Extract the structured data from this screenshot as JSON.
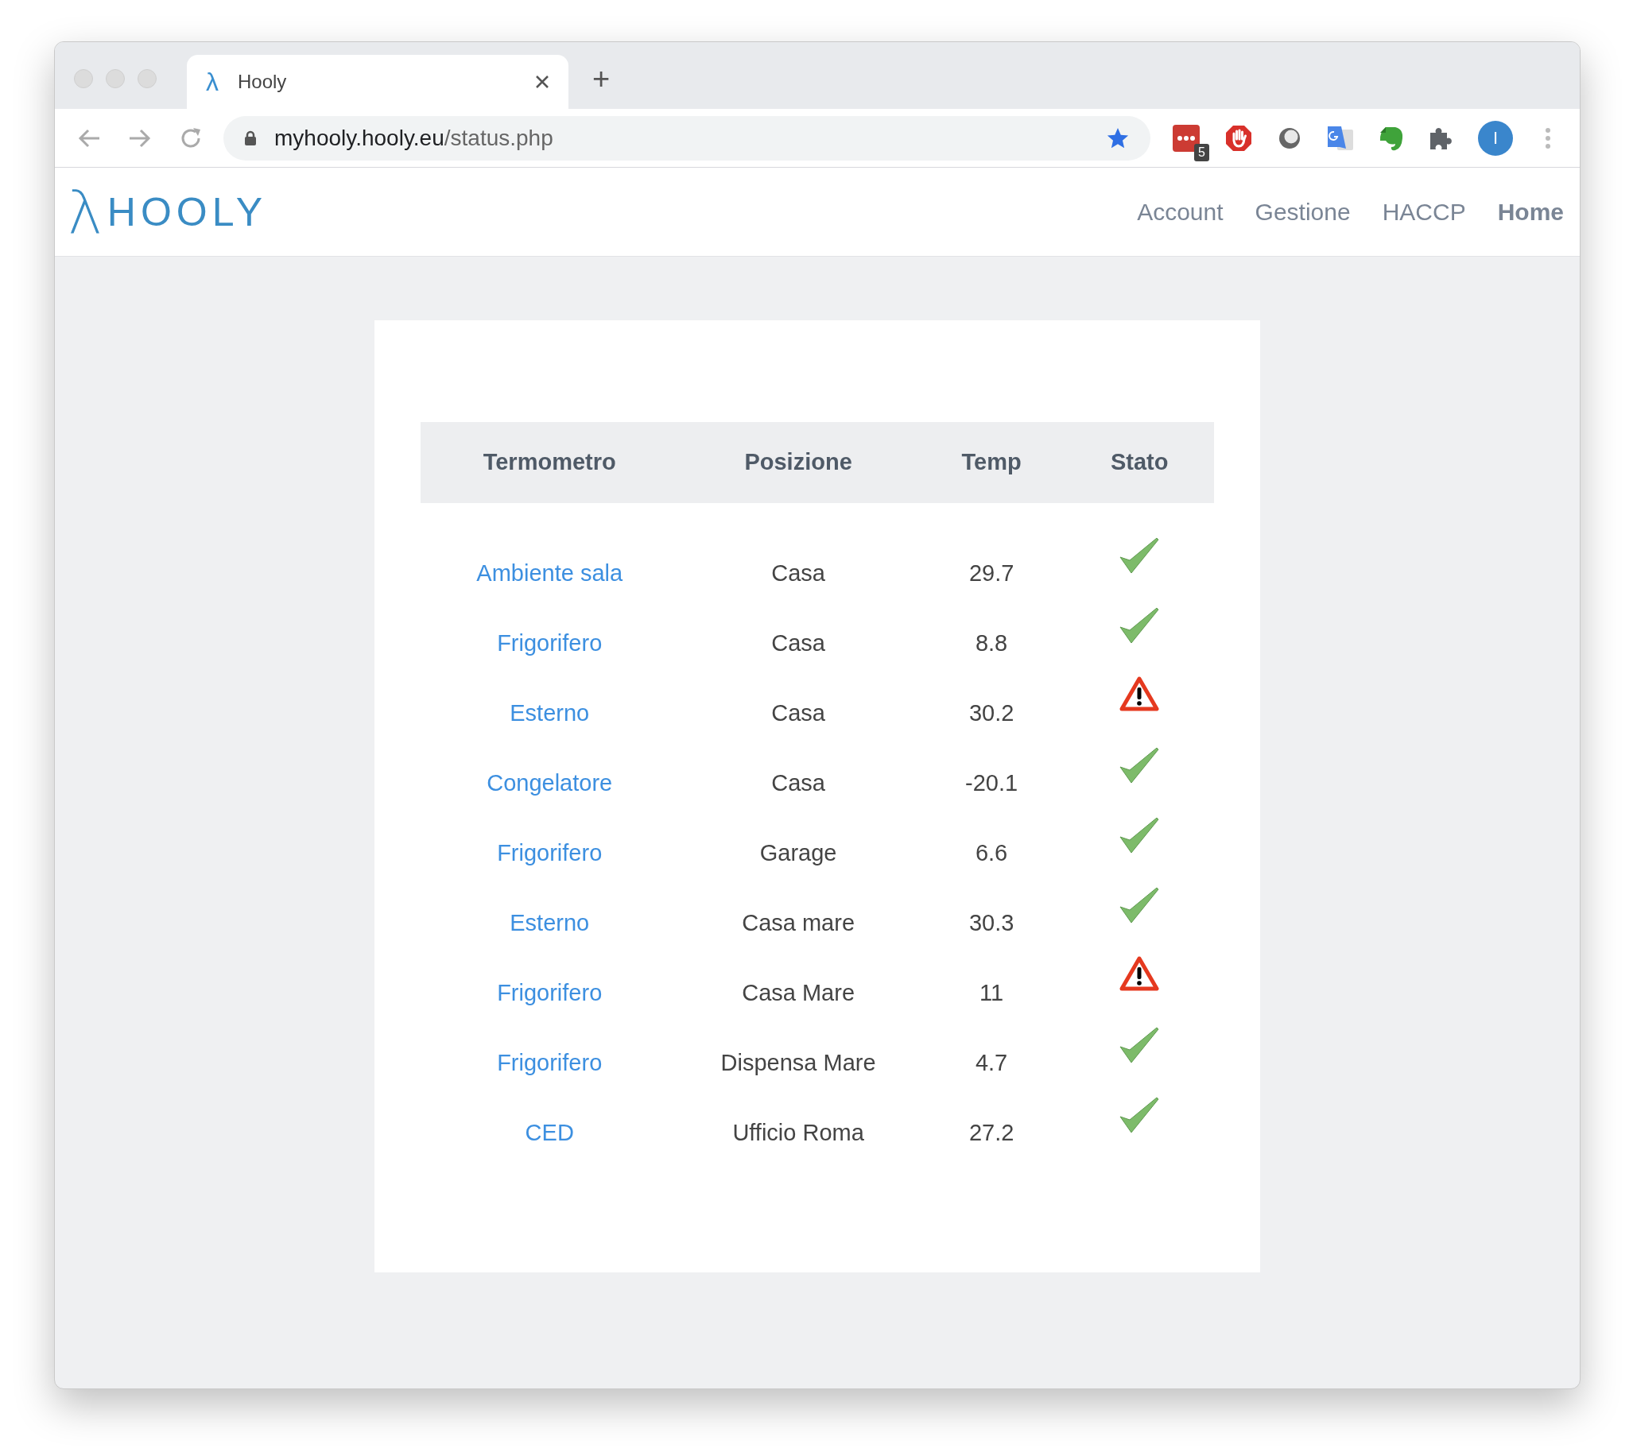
{
  "browser": {
    "tab_title": "Hooly",
    "tab_icon": "λ",
    "new_tab": "+",
    "url_host": "myhooly.hooly.eu",
    "url_path": "/status.php",
    "extension_badge": "5",
    "profile_initial": "I"
  },
  "navbar": {
    "logo_symbol": "λ",
    "logo_text": "HOOLY",
    "links": [
      {
        "label": "Account",
        "selected": false
      },
      {
        "label": "Gestione",
        "selected": false
      },
      {
        "label": "HACCP",
        "selected": false
      },
      {
        "label": "Home",
        "selected": true
      }
    ]
  },
  "table": {
    "columns": [
      "Termometro",
      "Posizione",
      "Temp",
      "Stato"
    ],
    "rows": [
      {
        "name": "Ambiente sala",
        "position": "Casa",
        "temp": "29.7",
        "status": {
          "kind": "ok"
        }
      },
      {
        "name": "Frigorifero",
        "position": "Casa",
        "temp": "8.8",
        "status": {
          "kind": "ok"
        }
      },
      {
        "name": "Esterno",
        "position": "Casa",
        "temp": "30.2",
        "status": {
          "kind": "warning"
        }
      },
      {
        "name": "Congelatore",
        "position": "Casa",
        "temp": "-20.1",
        "status": {
          "kind": "ok"
        }
      },
      {
        "name": "Frigorifero",
        "position": "Garage",
        "temp": "6.6",
        "status": {
          "kind": "ok"
        }
      },
      {
        "name": "Esterno",
        "position": "Casa mare",
        "temp": "30.3",
        "status": {
          "kind": "ok"
        }
      },
      {
        "name": "Frigorifero",
        "position": "Casa Mare",
        "temp": "11",
        "status": {
          "kind": "warning"
        }
      },
      {
        "name": "Frigorifero",
        "position": "Dispensa Mare",
        "temp": "4.7",
        "status": {
          "kind": "ok"
        }
      },
      {
        "name": "CED",
        "position": "Ufficio Roma",
        "temp": "27.2",
        "status": {
          "kind": "ok"
        }
      }
    ]
  }
}
